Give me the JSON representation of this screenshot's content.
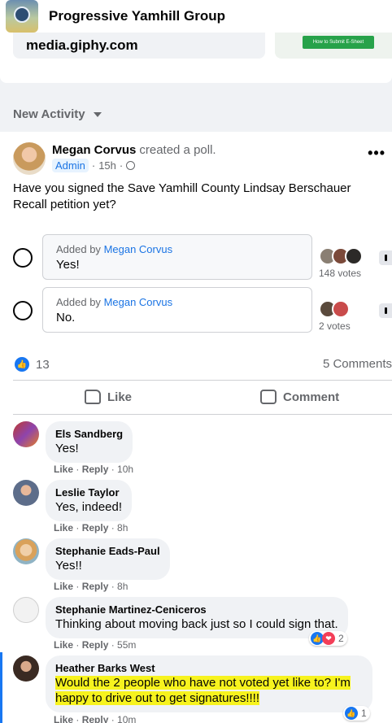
{
  "group": {
    "name": "Progressive Yamhill Group"
  },
  "share": {
    "domain": "media.giphy.com",
    "thumb_button": "How to Submit E-Sheet"
  },
  "feed": {
    "sort_label": "New Activity"
  },
  "post": {
    "author": "Megan Corvus",
    "action": "created a poll.",
    "badge": "Admin",
    "time": "15h",
    "text": "Have you signed the Save Yamhill County Lindsay Berschauer Recall petition yet?",
    "more": "•••",
    "poll": [
      {
        "added_prefix": "Added by",
        "added_by": "Megan Corvus",
        "label": "Yes!",
        "votes": "148 votes"
      },
      {
        "added_prefix": "Added by",
        "added_by": "Megan Corvus",
        "label": "No.",
        "votes": "2 votes"
      }
    ],
    "reaction_count": "13",
    "comments_count": "5 Comments",
    "like_label": "Like",
    "comment_label": "Comment"
  },
  "comments": [
    {
      "name": "Els Sandberg",
      "text": "Yes!",
      "like": "Like",
      "reply": "Reply",
      "time": "10h"
    },
    {
      "name": "Leslie Taylor",
      "text": "Yes, indeed!",
      "like": "Like",
      "reply": "Reply",
      "time": "8h"
    },
    {
      "name": "Stephanie Eads-Paul",
      "text": "Yes!!",
      "like": "Like",
      "reply": "Reply",
      "time": "8h"
    },
    {
      "name": "Stephanie Martinez-Ceniceros",
      "text": "Thinking about moving back just so I could sign that.",
      "like": "Like",
      "reply": "Reply",
      "time": "55m",
      "reactions": "2"
    },
    {
      "name": "Heather Barks West",
      "text_line1": "Would the 2 people who have not voted yet like to? I'm",
      "text_line2": "happy to drive out to get signatures!!!!",
      "like": "Like",
      "reply": "Reply",
      "time": "10m",
      "reactions": "1"
    }
  ],
  "colors": {
    "accent": "#1877f2",
    "highlight": "#f7f31e",
    "secondary_text": "#65676b"
  }
}
